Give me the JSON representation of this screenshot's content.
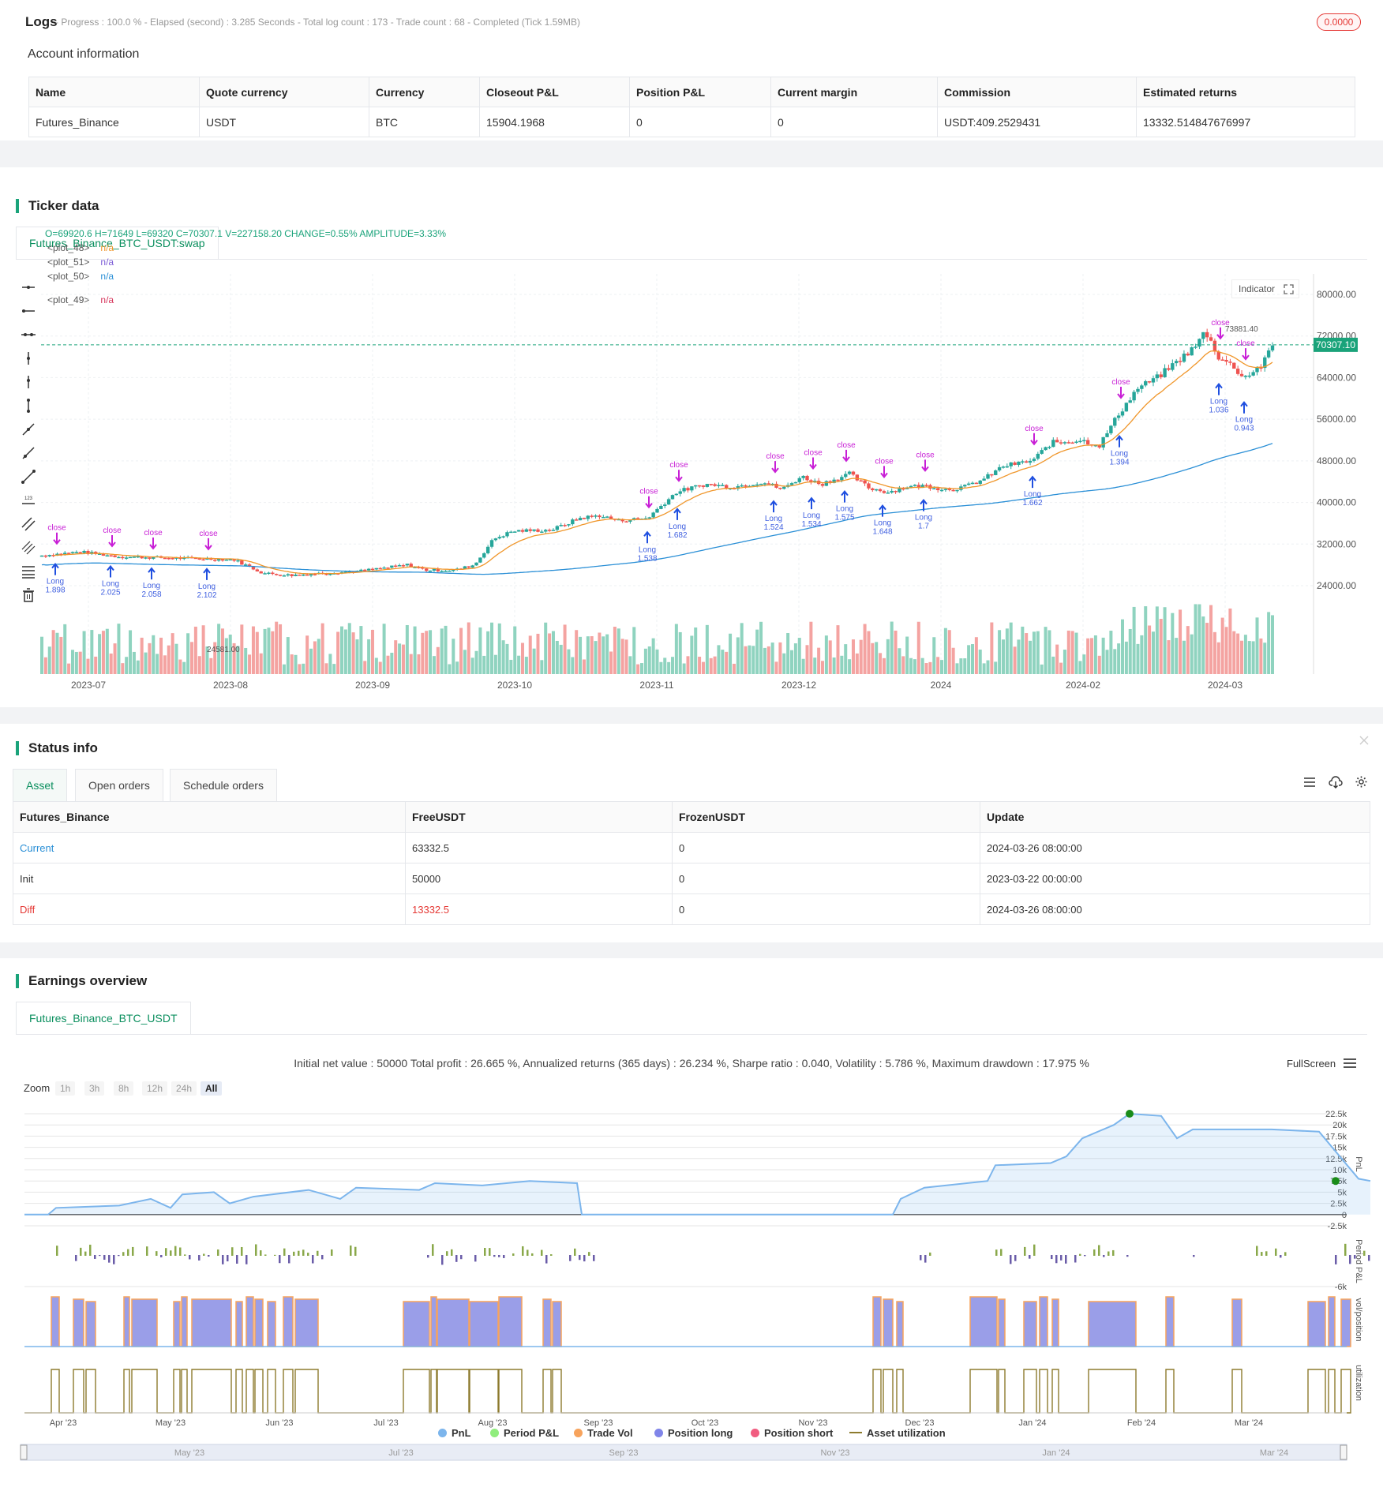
{
  "logs": {
    "title": "Logs",
    "progress": "- Progress : 100.0 % - Elapsed (second) : 3.285  Seconds - Total log count : 173 - Trade count : 68 - Completed (Tick 1.59MB)",
    "badge": "0.0000",
    "badge_color": "#e53935"
  },
  "account": {
    "title": "Account information",
    "headers": [
      "Name",
      "Quote currency",
      "Currency",
      "Closeout P&L",
      "Position P&L",
      "Current margin",
      "Commission",
      "Estimated returns"
    ],
    "row": [
      "Futures_Binance",
      "USDT",
      "BTC",
      "15904.1968",
      "0",
      "0",
      "USDT:409.2529431",
      "13332.514847676997"
    ]
  },
  "ticker": {
    "title": "Ticker data",
    "tab": "Futures_Binance_BTC_USDT:swap",
    "ohlc": "O=69920.6 H=71649 L=69320 C=70307.1 V=227158.20 CHANGE=0.55% AMPLITUDE=3.33%",
    "plots": [
      {
        "name": "<plot_48>",
        "value": "n/a",
        "color": "#f0962a"
      },
      {
        "name": "<plot_51>",
        "value": "n/a",
        "color": "#7b5bd6"
      },
      {
        "name": "<plot_50>",
        "value": "n/a",
        "color": "#2a8fd6"
      },
      {
        "name": "<plot_49>",
        "value": "n/a",
        "color": "#d6335a"
      }
    ],
    "indicator_label": "Indicator",
    "price_tag": "70307.10",
    "high_label": "73881.40",
    "low_label": "24581.00",
    "y_ticks": [
      "80000.00",
      "72000.00",
      "64000.00",
      "56000.00",
      "48000.00",
      "40000.00",
      "32000.00",
      "24000.00"
    ],
    "x_ticks": [
      "2023-07",
      "2023-08",
      "2023-09",
      "2023-10",
      "2023-11",
      "2023-12",
      "2024",
      "2024-02",
      "2024-03"
    ],
    "trade_labels": [
      {
        "text": "Long\n1.898",
        "side": "long"
      },
      {
        "text": "Long\n2.025",
        "side": "long"
      },
      {
        "text": "Long\n2.058",
        "side": "long"
      },
      {
        "text": "Long\n2.102",
        "side": "long"
      },
      {
        "text": "Long\n1.538",
        "side": "long"
      },
      {
        "text": "Long\n1.682",
        "side": "long"
      },
      {
        "text": "Long\n1.524",
        "side": "long"
      },
      {
        "text": "Long\n1.534",
        "side": "long"
      },
      {
        "text": "Long\n1.575",
        "side": "long"
      },
      {
        "text": "Long\n1.648",
        "side": "long"
      },
      {
        "text": "Long\n1.7",
        "side": "long"
      },
      {
        "text": "Long\n1.662",
        "side": "long"
      },
      {
        "text": "Long\n1.394",
        "side": "long"
      },
      {
        "text": "Long\n1.036",
        "side": "long"
      },
      {
        "text": "Long\n0.943",
        "side": "long"
      }
    ],
    "close_label": "close",
    "colors": {
      "up": "#26a69a",
      "down": "#ef5350",
      "ema": "#f0962a",
      "sma": "#2a8fd6",
      "marker": "#c81fd6",
      "long": "#1f4fe0"
    }
  },
  "status": {
    "title": "Status info",
    "tabs": [
      "Asset",
      "Open orders",
      "Schedule orders"
    ],
    "headers": [
      "Futures_Binance",
      "FreeUSDT",
      "FrozenUSDT",
      "Update"
    ],
    "rows": [
      [
        "Current",
        "63332.5",
        "0",
        "2024-03-26 08:00:00"
      ],
      [
        "Init",
        "50000",
        "0",
        "2023-03-22 00:00:00"
      ],
      [
        "Diff",
        "13332.5",
        "0",
        "2024-03-26 08:00:00"
      ]
    ]
  },
  "earnings": {
    "title": "Earnings overview",
    "tab": "Futures_Binance_BTC_USDT",
    "summary": "Initial net value : 50000 Total profit : 26.665 %, Annualized returns (365 days) : 26.234 %, Sharpe ratio : 0.040, Volatility : 5.786 %, Maximum drawdown : 17.975 %",
    "fullscreen": "FullScreen",
    "zoom_label": "Zoom",
    "zoom_buttons": [
      "1h",
      "3h",
      "8h",
      "12h",
      "24h",
      "All"
    ],
    "pnl_ticks": [
      "22.5k",
      "20k",
      "17.5k",
      "15k",
      "12.5k",
      "10k",
      "7.5k",
      "5k",
      "2.5k",
      "0",
      "-2.5k"
    ],
    "period_tick": "-6k",
    "axis_titles": [
      "PnL",
      "Period P&L",
      "vol/position",
      "utilization"
    ],
    "x_ticks": [
      "Apr '23",
      "May '23",
      "Jun '23",
      "Jul '23",
      "Aug '23",
      "Sep '23",
      "Oct '23",
      "Nov '23",
      "Dec '23",
      "Jan '24",
      "Feb '24",
      "Mar '24"
    ],
    "nav_ticks": [
      "May '23",
      "Jul '23",
      "Sep '23",
      "Nov '23",
      "Jan '24",
      "Mar '24"
    ],
    "legend": [
      {
        "name": "PnL",
        "color": "#7cb5ec"
      },
      {
        "name": "Period P&L",
        "color": "#90ed7d"
      },
      {
        "name": "Trade Vol",
        "color": "#f7a35c"
      },
      {
        "name": "Position long",
        "color": "#8085e9"
      },
      {
        "name": "Position short",
        "color": "#f15c80"
      },
      {
        "name": "Asset utilization",
        "color": "#8d7b2e"
      }
    ]
  }
}
